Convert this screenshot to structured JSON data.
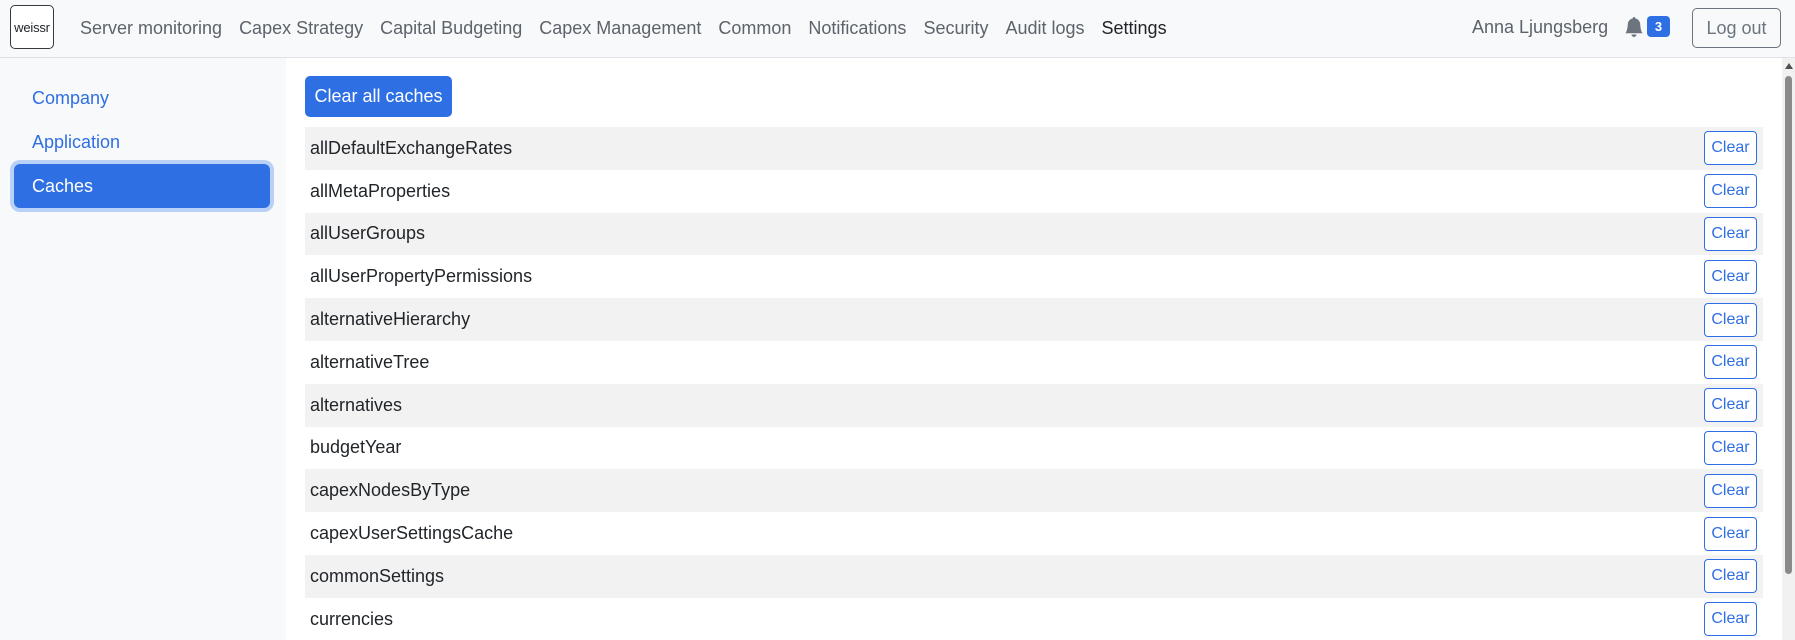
{
  "header": {
    "logo_text": "weissr",
    "nav": [
      {
        "label": "Server monitoring",
        "active": false
      },
      {
        "label": "Capex Strategy",
        "active": false
      },
      {
        "label": "Capital Budgeting",
        "active": false
      },
      {
        "label": "Capex Management",
        "active": false
      },
      {
        "label": "Common",
        "active": false
      },
      {
        "label": "Notifications",
        "active": false
      },
      {
        "label": "Security",
        "active": false
      },
      {
        "label": "Audit logs",
        "active": false
      },
      {
        "label": "Settings",
        "active": true
      }
    ],
    "user_name": "Anna Ljungsberg",
    "notification_icon": "bell-icon",
    "notification_count": "3",
    "logout_label": "Log out"
  },
  "sidebar": {
    "items": [
      {
        "label": "Company",
        "active": false
      },
      {
        "label": "Application",
        "active": false
      },
      {
        "label": "Caches",
        "active": true
      }
    ]
  },
  "main": {
    "clear_all_label": "Clear all caches",
    "clear_label": "Clear",
    "caches": [
      "allDefaultExchangeRates",
      "allMetaProperties",
      "allUserGroups",
      "allUserPropertyPermissions",
      "alternativeHierarchy",
      "alternativeTree",
      "alternatives",
      "budgetYear",
      "capexNodesByType",
      "capexUserSettingsCache",
      "commonSettings",
      "currencies"
    ]
  },
  "colors": {
    "primary": "#2f6fe4",
    "topbar_bg": "#f8f9fa",
    "row_stripe": "#f2f2f2"
  }
}
